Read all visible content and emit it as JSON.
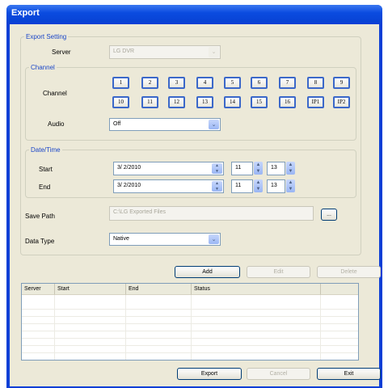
{
  "window": {
    "title": "Export"
  },
  "export_setting": {
    "legend": "Export Setting",
    "server_label": "Server",
    "server_value": "LG DVR"
  },
  "channel_group": {
    "legend": "Channel",
    "channel_label": "Channel",
    "buttons_row1": [
      "1",
      "2",
      "3",
      "4",
      "5",
      "6",
      "7",
      "8",
      "9"
    ],
    "buttons_row2": [
      "10",
      "11",
      "12",
      "13",
      "14",
      "15",
      "16",
      "IP1",
      "IP2"
    ],
    "audio_label": "Audio",
    "audio_value": "Off"
  },
  "datetime_group": {
    "legend": "Date/Time",
    "start_label": "Start",
    "start_date": "3/ 2/2010",
    "start_hour": "11",
    "start_minute": "13",
    "end_label": "End",
    "end_date": "3/ 2/2010",
    "end_hour": "11",
    "end_minute": "13"
  },
  "save_path": {
    "label": "Save Path",
    "value": "C:\\LG Exported Files",
    "browse_label": "..."
  },
  "data_type": {
    "label": "Data Type",
    "value": "Native"
  },
  "list_actions": {
    "add": "Add",
    "edit": "Edit",
    "delete": "Delete"
  },
  "table": {
    "columns": [
      "Server",
      "Start",
      "End",
      "Status",
      ""
    ]
  },
  "footer": {
    "export": "Export",
    "cancel": "Cancel",
    "exit": "Exit"
  },
  "colors": {
    "titlebar": "#0a4be0",
    "legend_text": "#1a46c8",
    "dialog_bg": "#ece9d8"
  },
  "icons": {
    "dropdown": "chevron-down-icon",
    "spin": "spin-updown-icon"
  }
}
